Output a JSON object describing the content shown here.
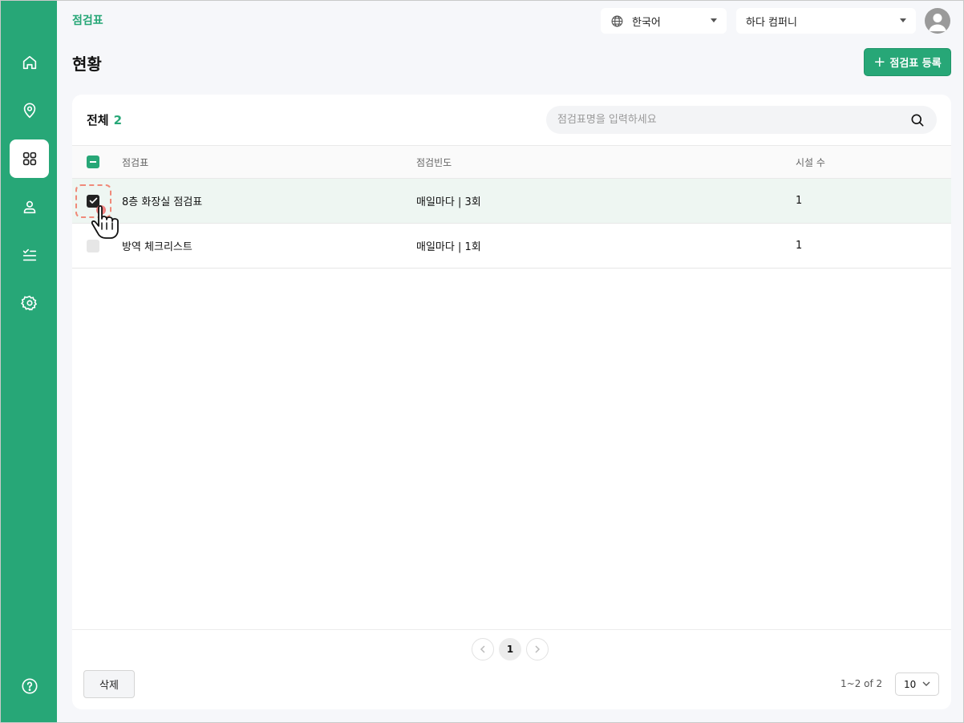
{
  "sidebar": {
    "items": [
      {
        "icon": "home-icon",
        "active": false
      },
      {
        "icon": "location-pin-icon",
        "active": false
      },
      {
        "icon": "grid-icon",
        "active": true
      },
      {
        "icon": "user-icon",
        "active": false
      },
      {
        "icon": "checklist-icon",
        "active": false
      },
      {
        "icon": "gear-icon",
        "active": false
      },
      {
        "icon": "help-icon",
        "active": false
      }
    ]
  },
  "header": {
    "breadcrumb": "점검표",
    "language": "한국어",
    "company": "하다 컴퍼니"
  },
  "page": {
    "title": "현황",
    "add_button": "점검표 등록",
    "add_button_icon": "+"
  },
  "list": {
    "total_label": "전체",
    "total_count": "2",
    "search_placeholder": "점검표명을 입력하세요",
    "columns": {
      "name": "점검표",
      "frequency": "점검빈도",
      "facilities": "시설 수"
    },
    "rows": [
      {
        "name": "8층 화장실 점검표",
        "frequency": "매일마다 | 3회",
        "facilities": "1",
        "checked": true
      },
      {
        "name": "방역 체크리스트",
        "frequency": "매일마다 | 1회",
        "facilities": "1",
        "checked": false
      }
    ]
  },
  "footer": {
    "delete_button": "삭제",
    "current_page": "1",
    "range": "1~2 of 2",
    "page_size": "10"
  },
  "colors": {
    "brand": "#27a777",
    "selected_row": "#eef6f2",
    "focus_ring": "#f08a7a"
  }
}
